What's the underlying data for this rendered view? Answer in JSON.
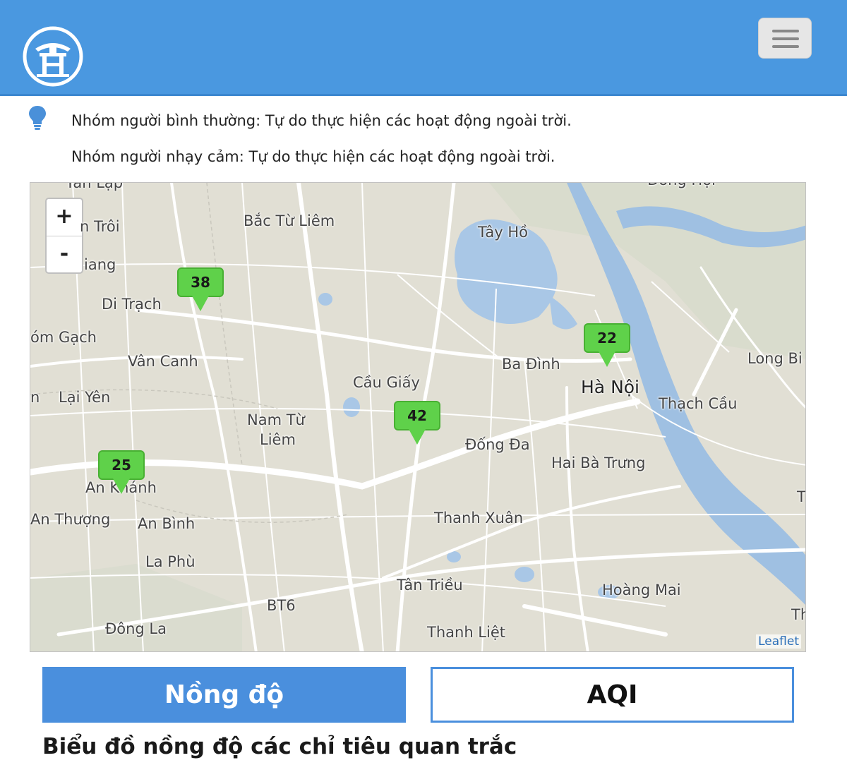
{
  "header": {
    "logo_icon": "hanoi-khue-van-cac-logo",
    "menu_icon": "hamburger-menu-icon",
    "background_color": "#4a98e0"
  },
  "advice": {
    "icon": "lightbulb-icon",
    "normal_group": "Nhóm người bình thường: Tự do thực hiện các hoạt động ngoài trời.",
    "sensitive_group": "Nhóm người nhạy cảm: Tự do thực hiện các hoạt động ngoài trời."
  },
  "map": {
    "zoom_in": "+",
    "zoom_out": "-",
    "attribution": "Leaflet",
    "places": {
      "tan_lap": "Tân Lập",
      "tan_troi": "n Trôi",
      "giang": "iang",
      "bac_tu_liem": "Bắc Từ Liêm",
      "tay_ho": "Tây Hồ",
      "dong_hoi": "Đông Hội",
      "di_trach": "Di Trạch",
      "om_gach": "óm Gạch",
      "van_canh": "Vân Canh",
      "lai_yen": "Lại Yên",
      "n": "n",
      "cau_giay": "Cầu Giấy",
      "ba_dinh": "Ba Đình",
      "ha_noi": "Hà Nội",
      "long_bien": "Long Bi",
      "thach_cau": "Thạch Cầu",
      "nam_tu_liem_1": "Nam Từ",
      "nam_tu_liem_2": "Liêm",
      "dong_da": "Đống Đa",
      "hai_ba_trung": "Hai Bà Trưng",
      "an_khanh": "An Khánh",
      "an_thuong": "An Thượng",
      "an_binh": "An Bình",
      "thanh_xuan": "Thanh Xuân",
      "la_phu": "La Phù",
      "tan_trieu": "Tân Triều",
      "hoang_mai": "Hoàng Mai",
      "bt6": "BT6",
      "dong_la": "Đông La",
      "thanh_liet": "Thanh Liệt",
      "t_right": "T",
      "th_right": "Th"
    },
    "markers": [
      {
        "value": "38",
        "color": "#5fd14a"
      },
      {
        "value": "22",
        "color": "#5fd14a"
      },
      {
        "value": "42",
        "color": "#5fd14a"
      },
      {
        "value": "25",
        "color": "#5fd14a"
      }
    ]
  },
  "tabs": {
    "concentration": "Nồng độ",
    "aqi": "AQI",
    "active_color": "#4a8fdd"
  },
  "section": {
    "title": "Biểu đồ nồng độ các chỉ tiêu quan trắc"
  }
}
